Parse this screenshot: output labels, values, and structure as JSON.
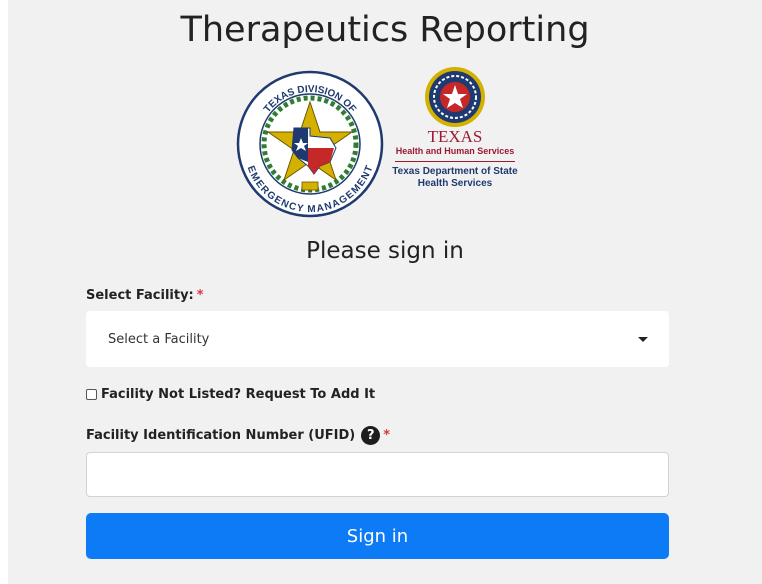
{
  "page": {
    "title": "Therapeutics Reporting",
    "heading": "Please sign in"
  },
  "logos": {
    "tdem": {
      "icon": "texas-division-of-emergency-management-seal",
      "text_top": "TEXAS DIVISION OF",
      "text_bottom": "EMERGENCY MANAGEMENT"
    },
    "dshs": {
      "icon": "texas-hhs-seal",
      "texas": "TEXAS",
      "hhs": "Health and Human Services",
      "dept_line1": "Texas Department of State",
      "dept_line2": "Health Services"
    }
  },
  "form": {
    "facility_label": "Select Facility:",
    "required_mark": "*",
    "facility_select_value": "Select a Facility",
    "not_listed_label": "Facility Not Listed? Request To Add It",
    "not_listed_checked": false,
    "ufid_label": "Facility Identification Number (UFID)",
    "ufid_help_icon": "?",
    "ufid_value": "",
    "ufid_placeholder": "",
    "submit_label": "Sign in"
  },
  "colors": {
    "background": "#f1f1f1",
    "primary_button": "#0d7bf5",
    "required": "#dc3545",
    "dshs_red": "#9b1b30",
    "dshs_blue": "#1f3a70"
  }
}
